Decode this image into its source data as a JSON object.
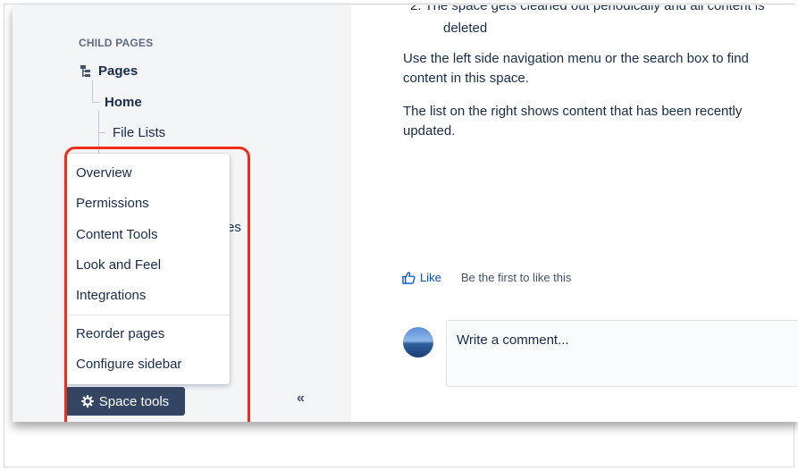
{
  "sidebar": {
    "child_pages_heading": "CHILD PAGES",
    "tree": {
      "root": "Pages",
      "home": "Home",
      "file_lists": "File Lists",
      "partial_item_suffix": "es"
    },
    "space_tools_menu": {
      "items": [
        "Overview",
        "Permissions",
        "Content Tools",
        "Look and Feel",
        "Integrations"
      ],
      "secondary_items": [
        "Reorder pages",
        "Configure sidebar"
      ]
    },
    "space_tools_button_label": "Space tools",
    "collapse_label": "«"
  },
  "content": {
    "list_item_cut": "2. The space gets cleaned out periodically and all content is",
    "list_item_continuation": "deleted",
    "paragraph_1": "Use the left side navigation menu or the search box to find content in this space.",
    "paragraph_2": "The list on the right shows content that has been recently updated.",
    "like_label": "Like",
    "like_prompt": "Be the first to like this",
    "comment_placeholder": "Write a comment..."
  },
  "colors": {
    "sidebar_bg": "#f4f5f7",
    "space_tools_bg": "#344563",
    "link": "#0052cc",
    "highlight": "#f02d16"
  }
}
